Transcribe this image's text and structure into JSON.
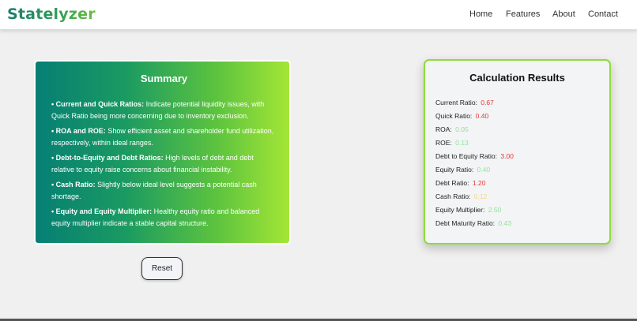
{
  "header": {
    "logo": "Statelyzer",
    "nav": [
      "Home",
      "Features",
      "About",
      "Contact"
    ]
  },
  "summary": {
    "title": "Summary",
    "items": [
      {
        "label": "• Current and Quick Ratios:",
        "text": " Indicate potential liquidity issues, with Quick Ratio being more concerning due to inventory exclusion."
      },
      {
        "label": "• ROA and ROE:",
        "text": " Show efficient asset and shareholder fund utilization, respectively, within ideal ranges."
      },
      {
        "label": "• Debt-to-Equity and Debt Ratios:",
        "text": " High levels of debt and debt relative to equity raise concerns about financial instability."
      },
      {
        "label": "• Cash Ratio:",
        "text": " Slightly below ideal level suggests a potential cash shortage."
      },
      {
        "label": "• Equity and Equity Multiplier:",
        "text": " Healthy equity ratio and balanced equity multiplier indicate a stable capital structure."
      }
    ]
  },
  "reset_label": "Reset",
  "results": {
    "title": "Calculation Results",
    "metrics": [
      {
        "label": "Current Ratio:",
        "value": "0.67",
        "status": "bad"
      },
      {
        "label": "Quick Ratio:",
        "value": "0.40",
        "status": "bad"
      },
      {
        "label": "ROA:",
        "value": "0.05",
        "status": "good"
      },
      {
        "label": "ROE:",
        "value": "0.13",
        "status": "good"
      },
      {
        "label": "Debt to Equity Ratio:",
        "value": "3.00",
        "status": "bad"
      },
      {
        "label": "Equity Ratio:",
        "value": "0.40",
        "status": "good"
      },
      {
        "label": "Debt Ratio:",
        "value": "1.20",
        "status": "bad"
      },
      {
        "label": "Cash Ratio:",
        "value": "0.12",
        "status": "warn"
      },
      {
        "label": "Equity Multiplier:",
        "value": "2.50",
        "status": "good"
      },
      {
        "label": "Debt Maturity Ratio:",
        "value": "0.43",
        "status": "good"
      }
    ]
  },
  "colors": {
    "bad": "#e53935",
    "good": "#8fe39a",
    "warn": "#f6d68a",
    "accent": "#8fdc39"
  }
}
